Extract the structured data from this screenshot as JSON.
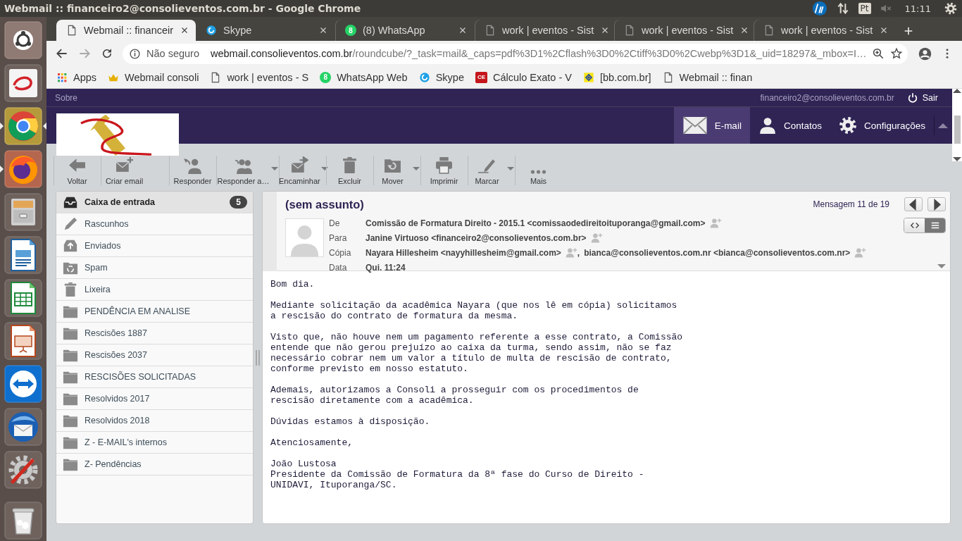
{
  "top_bar": {
    "title": "Webmail :: financeiro2@consolieventos.com.br - Google Chrome",
    "keyboard": "Pt",
    "clock": "11:11"
  },
  "launcher": [
    {
      "kind": "dash",
      "running": false,
      "focused": false
    },
    {
      "kind": "swoosh",
      "running": false,
      "focused": false
    },
    {
      "kind": "chrome",
      "running": true,
      "focused": true
    },
    {
      "kind": "firefox",
      "running": true,
      "focused": false
    },
    {
      "kind": "files",
      "running": false,
      "focused": false
    },
    {
      "kind": "writer",
      "running": false,
      "focused": false
    },
    {
      "kind": "calc",
      "running": false,
      "focused": false
    },
    {
      "kind": "impress",
      "running": false,
      "focused": false
    },
    {
      "kind": "remote",
      "running": false,
      "focused": false
    },
    {
      "kind": "mail",
      "running": false,
      "focused": false
    },
    {
      "kind": "settings",
      "running": false,
      "focused": false
    },
    {
      "kind": "trash",
      "running": false,
      "focused": false
    }
  ],
  "tabs": [
    {
      "label": "Webmail :: financeir",
      "kind": "page",
      "selected": true
    },
    {
      "label": "Skype",
      "kind": "skype",
      "selected": false
    },
    {
      "label": "(8) WhatsApp",
      "kind": "whatsapp",
      "badge": "8",
      "selected": false
    },
    {
      "label": "work | eventos - Sist",
      "kind": "page",
      "selected": false
    },
    {
      "label": "work | eventos - Sist",
      "kind": "page",
      "selected": false
    },
    {
      "label": "work | eventos - Sist",
      "kind": "page",
      "selected": false
    }
  ],
  "address_bar": {
    "security": "Não seguro",
    "host": "webmail.consolieventos.com.br",
    "path": "/roundcube/?_task=mail&_caps=pdf%3D1%2Cflash%3D0%2Ctiff%3D0%2Cwebp%3D1&_uid=18297&_mbox=I…"
  },
  "bookmarks": [
    {
      "label": "Apps",
      "kind": "apps"
    },
    {
      "label": "Webmail consoli",
      "kind": "crown"
    },
    {
      "label": "work | eventos - S",
      "kind": "page"
    },
    {
      "label": "WhatsApp Web",
      "kind": "whatsapp",
      "badge": "8"
    },
    {
      "label": "Skype",
      "kind": "skype"
    },
    {
      "label": "Cálculo Exato - V",
      "kind": "ce",
      "badge": "CE"
    },
    {
      "label": "[bb.com.br]",
      "kind": "bb"
    },
    {
      "label": "Webmail :: finan",
      "kind": "page"
    }
  ],
  "webmail": {
    "about": "Sobre",
    "user": "financeiro2@consolieventos.com.br",
    "logout": "Sair",
    "nav": [
      {
        "label": "E-mail",
        "kind": "mail",
        "selected": true
      },
      {
        "label": "Contatos",
        "kind": "person",
        "selected": false
      },
      {
        "label": "Configurações",
        "kind": "gear",
        "selected": false
      }
    ],
    "toolbar": [
      {
        "label": "Voltar",
        "kind": "back",
        "dropdown": false
      },
      {
        "label": "Criar email",
        "kind": "compose",
        "dropdown": false
      },
      {
        "label": "Responder",
        "kind": "reply",
        "dropdown": false
      },
      {
        "label": "Responder a…",
        "kind": "reply-all",
        "dropdown": true
      },
      {
        "label": "Encaminhar",
        "kind": "forward",
        "dropdown": true
      },
      {
        "label": "Excluir",
        "kind": "trash",
        "dropdown": false
      },
      {
        "label": "Mover",
        "kind": "move",
        "dropdown": true
      },
      {
        "label": "Imprimir",
        "kind": "print",
        "dropdown": false
      },
      {
        "label": "Marcar",
        "kind": "mark",
        "dropdown": true
      },
      {
        "label": "Mais",
        "kind": "dots",
        "dropdown": false
      }
    ],
    "folders": [
      {
        "label": "Caixa de entrada",
        "kind": "inbox",
        "selected": true,
        "unread": "5"
      },
      {
        "label": "Rascunhos",
        "kind": "drafts",
        "selected": false
      },
      {
        "label": "Enviados",
        "kind": "sent",
        "selected": false
      },
      {
        "label": "Spam",
        "kind": "junk",
        "selected": false
      },
      {
        "label": "Lixeira",
        "kind": "trash",
        "selected": false
      },
      {
        "label": "PENDÊNCIA EM ANALISE",
        "kind": "folder",
        "selected": false
      },
      {
        "label": "Rescisões 1887",
        "kind": "folder",
        "selected": false
      },
      {
        "label": "Rescisões 2037",
        "kind": "folder",
        "selected": false
      },
      {
        "label": "RESCISÕES SOLICITADAS",
        "kind": "folder",
        "selected": false
      },
      {
        "label": "Resolvidos 2017",
        "kind": "folder",
        "selected": false
      },
      {
        "label": "Resolvidos 2018",
        "kind": "folder",
        "selected": false
      },
      {
        "label": "Z - E-MAIL's internos",
        "kind": "folder",
        "selected": false
      },
      {
        "label": "Z- Pendências",
        "kind": "folder",
        "selected": false
      }
    ],
    "message": {
      "subject": "(sem assunto)",
      "counter": "Mensagem 11 de 19",
      "view_modes": [
        {
          "kind": "code",
          "selected": false
        },
        {
          "kind": "lines",
          "selected": true
        }
      ],
      "headers": [
        {
          "label": "De",
          "kind": "address",
          "contacts": [
            {
              "text": "Comissão de Formatura Direito - 2015.1 <comissaodedireitoituporanga@gmail.com>"
            }
          ]
        },
        {
          "label": "Para",
          "kind": "address",
          "contacts": [
            {
              "text": "Janine Virtuoso <financeiro2@consolieventos.com.br>"
            }
          ]
        },
        {
          "label": "Cópia",
          "kind": "address",
          "contacts": [
            {
              "text": "Nayara Hillesheim <nayyhillesheim@gmail.com>"
            },
            {
              "prefix": ",",
              "text": "bianca@consolieventos.com.nr <bianca@consolieventos.com.nr>"
            }
          ]
        },
        {
          "label": "Data",
          "kind": "date",
          "value": "Qui. 11:24"
        }
      ],
      "body": [
        "Bom dia.",
        "Mediante solicitação da acadêmica Nayara (que nos lê em cópia) solicitamos\na rescisão do contrato de formatura da mesma.",
        "Visto que, não houve nem um pagamento referente a esse contrato, a Comissão\nentende que não gerou prejuízo ao caixa da turma, sendo assim, não se faz\nnecessário cobrar nem um valor a título de multa de rescisão de contrato,\nconforme previsto em nosso estatuto.",
        "Ademais, autorizamos a Consoli a prosseguir com os procedimentos de\nrescisão diretamente com a acadêmica.",
        "Dúvidas estamos à disposição.",
        "Atenciosamente,",
        "João Lustosa\nPresidente da Comissão de Formatura da 8ª fase do Curso de Direito -\nUNIDAVI, Ituporanga/SC."
      ]
    }
  }
}
